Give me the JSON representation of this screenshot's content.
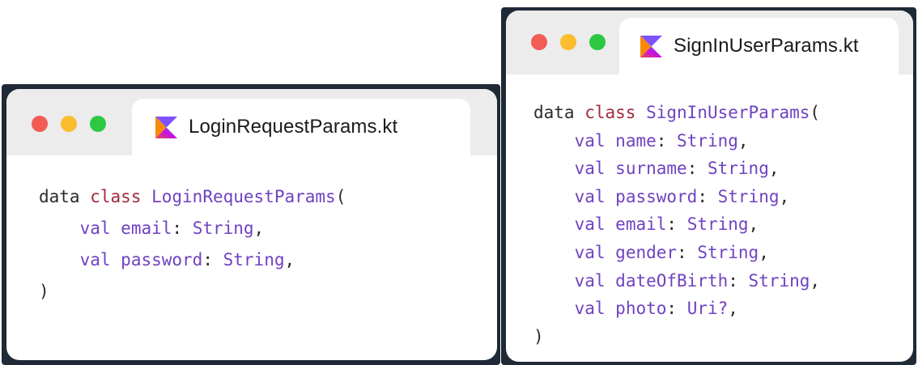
{
  "windows": [
    {
      "tab": {
        "file_name": "LoginRequestParams.kt",
        "icon": "kotlin-icon"
      },
      "traffic_lights": {
        "close": "#f35c55",
        "minimize": "#fbbd2e",
        "zoom": "#2cc842"
      },
      "code": {
        "kind": "data",
        "keyword": "class",
        "class_name": "LoginRequestParams",
        "open_paren": "(",
        "close_paren": ")",
        "val_keyword": "val",
        "params": [
          {
            "name": "email",
            "type": "String"
          },
          {
            "name": "password",
            "type": "String"
          }
        ]
      }
    },
    {
      "tab": {
        "file_name": "SignInUserParams.kt",
        "icon": "kotlin-icon"
      },
      "traffic_lights": {
        "close": "#f35c55",
        "minimize": "#fbbd2e",
        "zoom": "#2cc842"
      },
      "code": {
        "kind": "data",
        "keyword": "class",
        "class_name": "SignInUserParams",
        "open_paren": "(",
        "close_paren": ")",
        "val_keyword": "val",
        "params": [
          {
            "name": "name",
            "type": "String"
          },
          {
            "name": "surname",
            "type": "String"
          },
          {
            "name": "password",
            "type": "String"
          },
          {
            "name": "email",
            "type": "String"
          },
          {
            "name": "gender",
            "type": "String"
          },
          {
            "name": "dateOfBirth",
            "type": "String"
          },
          {
            "name": "photo",
            "type": "Uri?"
          }
        ]
      }
    }
  ],
  "syntax_colors": {
    "keyword": "#a2293f",
    "identifier": "#6f42c1",
    "plain": "#2b2b2b"
  }
}
